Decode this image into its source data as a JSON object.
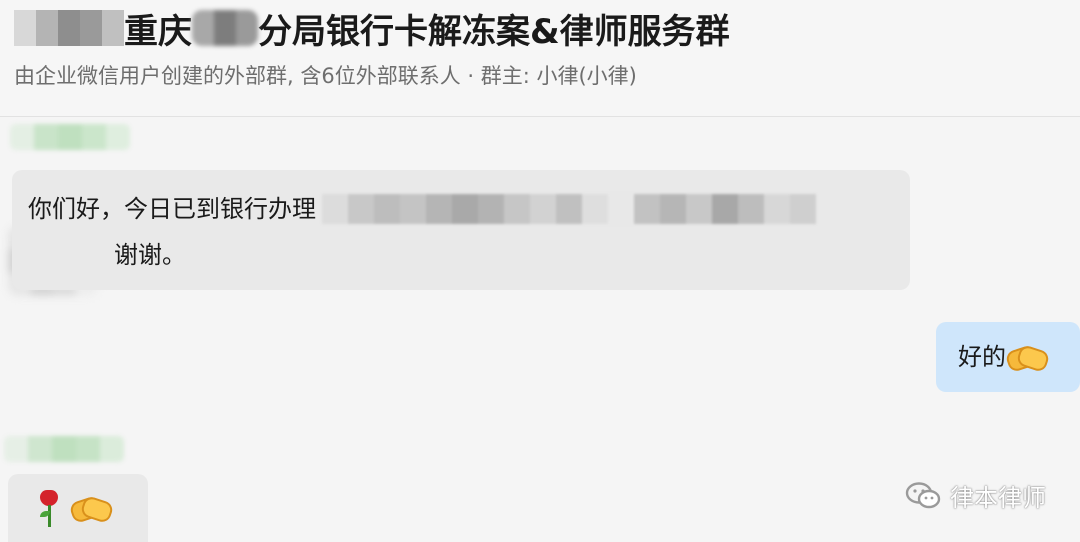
{
  "header": {
    "title_prefix": "重庆",
    "title_suffix": "分局银行卡解冻案&律师服务群",
    "subtitle": "由企业微信用户创建的外部群, 含6位外部联系人 · 群主: 小律(小律)"
  },
  "messages": [
    {
      "side": "left",
      "text_line1": "你们好，今日已到银行办理",
      "text_line2": "谢谢。"
    },
    {
      "side": "right",
      "text": "好的",
      "emoji": "handshake-emoji"
    },
    {
      "side": "left",
      "emojis": [
        "rose-emoji",
        "handshake-emoji"
      ]
    }
  ],
  "watermark": {
    "text": "律本律师",
    "icon": "wechat-icon"
  }
}
